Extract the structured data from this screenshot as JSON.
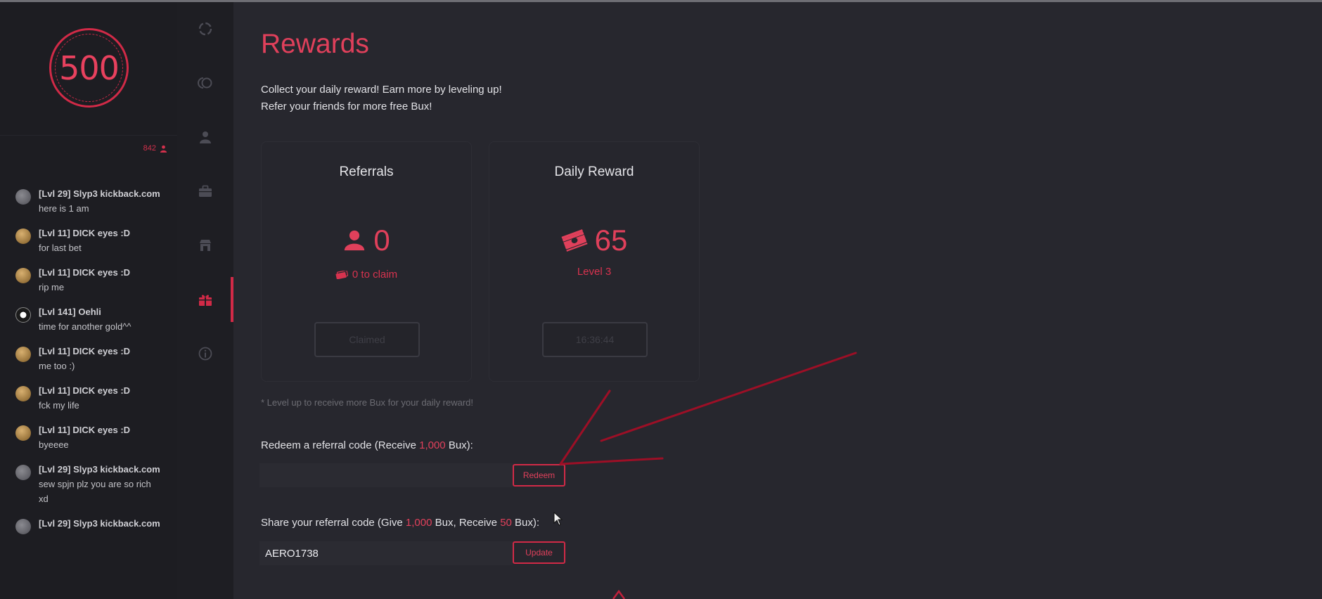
{
  "colors": {
    "accent": "#e0405b",
    "background": "#27272e",
    "sidebar": "#1d1d22"
  },
  "balance": "500",
  "online_count": "842",
  "chat": [
    {
      "user": "[Lvl 29] Slyp3 kickback.com",
      "text": "here is 1 am",
      "avatar": "gray"
    },
    {
      "user": "[Lvl 11] DICK eyes :D",
      "text": "for last bet",
      "avatar": "gold"
    },
    {
      "user": "[Lvl 11] DICK eyes :D",
      "text": "rip me",
      "avatar": "gold"
    },
    {
      "user": "[Lvl 141] Oehli",
      "text": "time for another gold^^",
      "avatar": "dark"
    },
    {
      "user": "[Lvl 11] DICK eyes :D",
      "text": "me too :)",
      "avatar": "gold"
    },
    {
      "user": "[Lvl 11] DICK eyes :D",
      "text": "fck my life",
      "avatar": "gold"
    },
    {
      "user": "[Lvl 11] DICK eyes :D",
      "text": "byeeee",
      "avatar": "gold"
    },
    {
      "user": "[Lvl 29] Slyp3 kickback.com",
      "text": "sew spjn plz you are so rich xd",
      "avatar": "gray"
    },
    {
      "user": "[Lvl 29] Slyp3 kickback.com",
      "text": "",
      "avatar": "gray"
    }
  ],
  "nav": [
    "roulette-icon",
    "coinflip-icon",
    "profile-icon",
    "briefcase-icon",
    "shop-icon",
    "gift-icon",
    "info-icon"
  ],
  "nav_active": "gift-icon",
  "page": {
    "title": "Rewards",
    "intro_line1": "Collect your daily reward! Earn more by leveling up!",
    "intro_line2": "Refer your friends for more free Bux!"
  },
  "referrals_card": {
    "title": "Referrals",
    "value": "0",
    "sub": "0 to claim",
    "button": "Claimed"
  },
  "daily_card": {
    "title": "Daily Reward",
    "value": "65",
    "sub": "Level 3",
    "button": "16:36:44"
  },
  "note": "* Level up to receive more Bux for your daily reward!",
  "redeem": {
    "label_pre": "Redeem a referral code (Receive ",
    "amount": "1,000",
    "label_post": " Bux):",
    "value": "",
    "button": "Redeem"
  },
  "share": {
    "label_pre": "Share your referral code (Give ",
    "give_amount": "1,000",
    "label_mid": " Bux, Receive ",
    "receive_amount": "50",
    "label_post": " Bux):",
    "value": "AERO1738",
    "button": "Update"
  }
}
